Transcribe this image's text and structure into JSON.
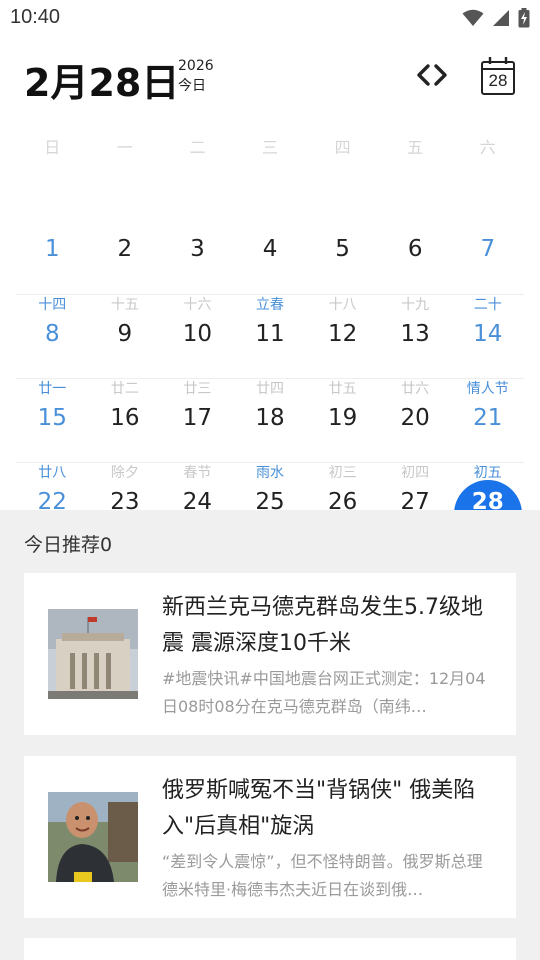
{
  "status_bar": {
    "time": "10:40"
  },
  "header": {
    "big_date": "2月28日",
    "year": "2026",
    "today_label": "今日",
    "calendar_icon_day": "28"
  },
  "weekdays": [
    "日",
    "一",
    "二",
    "三",
    "四",
    "五",
    "六"
  ],
  "calendar": {
    "rows": [
      [
        {
          "lunar": "",
          "day": "1",
          "weekend": true
        },
        {
          "lunar": "",
          "day": "2"
        },
        {
          "lunar": "",
          "day": "3"
        },
        {
          "lunar": "",
          "day": "4"
        },
        {
          "lunar": "",
          "day": "5"
        },
        {
          "lunar": "",
          "day": "6"
        },
        {
          "lunar": "",
          "day": "7",
          "weekend": true
        }
      ],
      [
        {
          "lunar": "十四",
          "day": "8",
          "weekend": true,
          "festival": true
        },
        {
          "lunar": "十五",
          "day": "9"
        },
        {
          "lunar": "十六",
          "day": "10"
        },
        {
          "lunar": "立春",
          "day": "11",
          "festival": true
        },
        {
          "lunar": "十八",
          "day": "12"
        },
        {
          "lunar": "十九",
          "day": "13"
        },
        {
          "lunar": "二十",
          "day": "14",
          "weekend": true,
          "festival": true
        }
      ],
      [
        {
          "lunar": "廿一",
          "day": "15",
          "weekend": true,
          "festival": true
        },
        {
          "lunar": "廿二",
          "day": "16"
        },
        {
          "lunar": "廿三",
          "day": "17"
        },
        {
          "lunar": "廿四",
          "day": "18"
        },
        {
          "lunar": "廿五",
          "day": "19"
        },
        {
          "lunar": "廿六",
          "day": "20"
        },
        {
          "lunar": "情人节",
          "day": "21",
          "weekend": true,
          "festival": true
        }
      ],
      [
        {
          "lunar": "廿八",
          "day": "22",
          "weekend": true,
          "festival": true
        },
        {
          "lunar": "除夕",
          "day": "23"
        },
        {
          "lunar": "春节",
          "day": "24"
        },
        {
          "lunar": "雨水",
          "day": "25",
          "festival": true
        },
        {
          "lunar": "初三",
          "day": "26"
        },
        {
          "lunar": "初四",
          "day": "27"
        },
        {
          "lunar": "初五",
          "day": "28",
          "weekend": true,
          "festival": true,
          "today": true
        }
      ]
    ]
  },
  "feed": {
    "title": "今日推荐0",
    "cards": [
      {
        "title": "新西兰克马德克群岛发生5.7级地震 震源深度10千米",
        "summary": "#地震快讯#中国地震台网正式测定：12月04日08时08分在克马德克群岛（南纬…"
      },
      {
        "title": "俄罗斯喊冤不当\"背锅侠\" 俄美陷入\"后真相\"旋涡",
        "summary": "“差到令人震惊”，但不怪特朗普。俄罗斯总理德米特里·梅德韦杰夫近日在谈到俄…"
      }
    ]
  },
  "colors": {
    "accent": "#1a73e8",
    "weekend": "#4a90d9",
    "feed_bg": "#f0f0f0"
  }
}
